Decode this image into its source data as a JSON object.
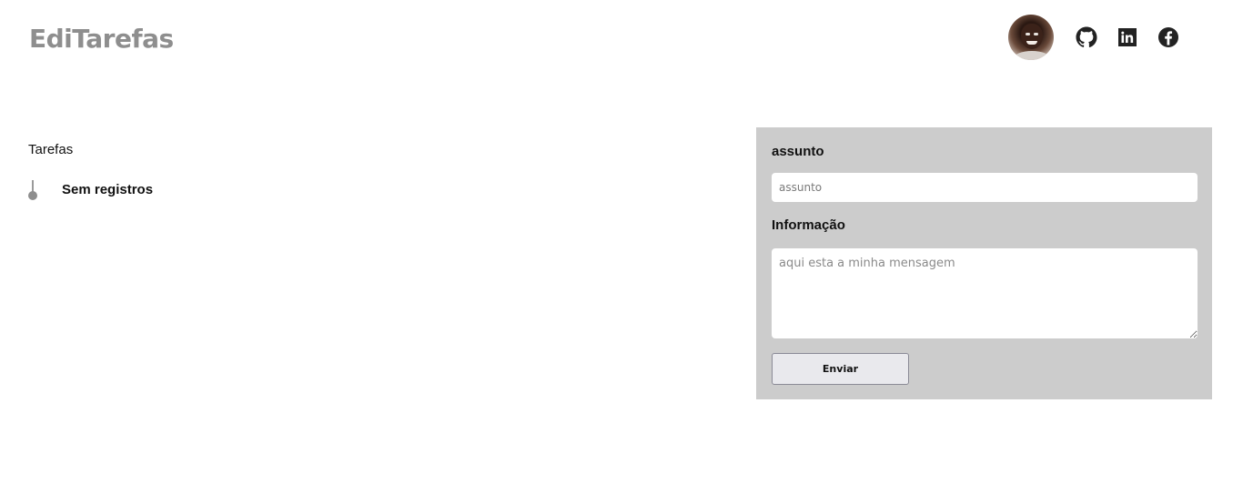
{
  "header": {
    "brand": "EdiTarefas",
    "social": [
      "github-icon",
      "linkedin-icon",
      "facebook-icon"
    ]
  },
  "tasks": {
    "title": "Tarefas",
    "empty_label": "Sem registros"
  },
  "form": {
    "subject_label": "assunto",
    "subject_placeholder": "assunto",
    "subject_value": "",
    "info_label": "Informação",
    "info_placeholder": "aqui esta a minha mensagem",
    "info_value": "",
    "submit_label": "Enviar"
  },
  "colors": {
    "brand": "#8e8e8e",
    "panel_bg": "#cccccc",
    "button_bg": "#e9e9ed"
  }
}
